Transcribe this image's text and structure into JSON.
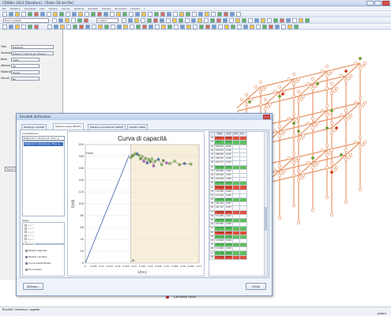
{
  "app": {
    "title": "CDSWin 2013 [Struttura] - [Telaio 3D del file]"
  },
  "menu": [
    "File",
    "Modifica",
    "Visualizza",
    "Dati",
    "Genera",
    "Calcola",
    "Verifiche",
    "Risultati",
    "Stampa",
    "Strumenti",
    "Finestra",
    "?"
  ],
  "toolbar": {
    "combo1": "Travi e pilastri",
    "combo2": "1 piano"
  },
  "left_panel": {
    "rows": [
      {
        "label": "Tipo",
        "value": "Elementi"
      },
      {
        "label": "Sezione",
        "value": "Trave a T (forma e1, Trave a"
      },
      {
        "label": "Base",
        "value": "1000"
      },
      {
        "label": "Altezza",
        "value": "40"
      },
      {
        "label": "Materiale",
        "value": "Guida"
      },
      {
        "label": "Vincoli",
        "value": "No"
      }
    ],
    "status_tab": "Rapporti"
  },
  "dialog": {
    "title": "Risultati dell'analisi",
    "tabs": [
      "Riepilogo risultati",
      "Sistema reale (MDOF)",
      "Sistema equivalente (SDOF)",
      "Spettro ADRS"
    ],
    "combinations_label": "Combinazioni",
    "combination_selected": "Pushover 1 (forma e1, Tran. e",
    "steps_label": "Steps",
    "steps": [
      "Cre 1",
      "Cre 2",
      "Cre 3",
      "Cre 4",
      "Cre 5",
      "Cre 6"
    ],
    "options_label": "Opzioni",
    "options": [
      {
        "label": "Mostra legenda",
        "checked": false
      },
      {
        "label": "Mostra cerniere",
        "checked": true
      },
      {
        "label": "Curva semplificata",
        "checked": true
      },
      {
        "label": "Zoom/Gain",
        "checked": false
      }
    ],
    "buttons": {
      "left": "Stampa...",
      "right": "Chiudi"
    }
  },
  "chart_data": {
    "type": "scatter",
    "title": "Curva di capacità",
    "xlabel": "U[m]",
    "ylabel": "F[kN]",
    "xlim": [
      0,
      0.07
    ],
    "ylim": [
      0,
      200
    ],
    "xticks": [
      "0",
      "0.005",
      "0.01",
      "0.015",
      "0.02",
      "0.025",
      "0.03",
      "0.035",
      "0.04",
      "0.045",
      "0.05",
      "0.055",
      "0.06",
      "0.065",
      "0.07"
    ],
    "yticks": [
      "0",
      "20",
      "40",
      "60",
      "80",
      "100",
      "120",
      "140",
      "160",
      "180",
      "200"
    ],
    "annotations": [
      "Fmax",
      "Dt"
    ],
    "marker_x": 0.028,
    "linear_segment": [
      [
        0,
        0
      ],
      [
        0.027,
        182
      ]
    ],
    "points": [
      {
        "x": 0.028,
        "y": 178,
        "c": "#8fbf5a"
      },
      {
        "x": 0.029,
        "y": 181,
        "c": "#6f9a45"
      },
      {
        "x": 0.03,
        "y": 183,
        "c": "#8fbf5a"
      },
      {
        "x": 0.031,
        "y": 185,
        "c": "#9ad06b"
      },
      {
        "x": 0.032,
        "y": 184,
        "c": "#4f7cc0"
      },
      {
        "x": 0.033,
        "y": 182,
        "c": "#8fbf5a"
      },
      {
        "x": 0.034,
        "y": 176,
        "c": "#6f9a45"
      },
      {
        "x": 0.035,
        "y": 180,
        "c": "#9ad06b"
      },
      {
        "x": 0.036,
        "y": 172,
        "c": "#b86bc9"
      },
      {
        "x": 0.037,
        "y": 177,
        "c": "#8fbf5a"
      },
      {
        "x": 0.038,
        "y": 169,
        "c": "#4f7cc0"
      },
      {
        "x": 0.039,
        "y": 175,
        "c": "#8fbf5a"
      },
      {
        "x": 0.04,
        "y": 171,
        "c": "#6f9a45"
      },
      {
        "x": 0.041,
        "y": 176,
        "c": "#9ad06b"
      },
      {
        "x": 0.042,
        "y": 164,
        "c": "#b86bc9"
      },
      {
        "x": 0.043,
        "y": 172,
        "c": "#8fbf5a"
      },
      {
        "x": 0.045,
        "y": 175,
        "c": "#4f7cc0"
      },
      {
        "x": 0.047,
        "y": 166,
        "c": "#8fbf5a"
      },
      {
        "x": 0.048,
        "y": 173,
        "c": "#6f9a45"
      },
      {
        "x": 0.05,
        "y": 169,
        "c": "#b86bc9"
      },
      {
        "x": 0.052,
        "y": 168,
        "c": "#8fbf5a"
      },
      {
        "x": 0.055,
        "y": 172,
        "c": "#9ad06b"
      },
      {
        "x": 0.058,
        "y": 166,
        "c": "#8fbf5a"
      },
      {
        "x": 0.061,
        "y": 168,
        "c": "#4f7cc0"
      },
      {
        "x": 0.065,
        "y": 167,
        "c": "#8fbf5a"
      }
    ]
  },
  "grid": {
    "headers": [
      "",
      "F[kN]",
      "U[m]",
      "Att%",
      "Pro..."
    ],
    "rows": [
      {
        "id": "40",
        "f": "175.3",
        "u": "0.022",
        "a": "",
        "p": "",
        "c": "r"
      },
      {
        "id": "40",
        "f": "181.6",
        "u": "0.024",
        "a": "",
        "p": "",
        "c": "g"
      },
      {
        "id": "41",
        "f": "180.522",
        "u": "0.025",
        "a": "",
        "p": "",
        "c": "w"
      },
      {
        "id": "42",
        "f": "183.813",
        "u": "0.025",
        "a": "",
        "p": "",
        "c": "w"
      },
      {
        "id": "43",
        "f": "188.626",
        "u": "0.025",
        "a": "",
        "p": "",
        "c": "w"
      },
      {
        "id": "44",
        "f": "182.512",
        "u": "0.025",
        "a": "",
        "p": "",
        "c": "w"
      },
      {
        "id": "45",
        "f": "183.747",
        "u": "0.025",
        "a": "",
        "p": "",
        "c": "w"
      },
      {
        "id": "46",
        "f": "183.742",
        "u": "0.025",
        "a": "",
        "p": "",
        "c": "g"
      },
      {
        "id": "47",
        "f": "184.950",
        "u": "0.025",
        "a": "",
        "p": "",
        "c": "w"
      },
      {
        "id": "48",
        "f": "184.000",
        "u": "0.025",
        "a": "",
        "p": "",
        "c": "w"
      },
      {
        "id": "49",
        "f": "185.444",
        "u": "0.025",
        "a": "",
        "p": "",
        "c": "w"
      },
      {
        "id": "50",
        "f": "184.778",
        "u": "0.025",
        "a": "",
        "p": "",
        "c": "g"
      },
      {
        "id": "51",
        "f": "173.821",
        "u": "0.026",
        "a": "",
        "p": "",
        "c": "r"
      },
      {
        "id": "52",
        "f": "172.500",
        "u": "0.026",
        "a": "",
        "p": "",
        "c": "w"
      },
      {
        "id": "53",
        "f": "171.404",
        "u": "0.026",
        "a": "",
        "p": "",
        "c": "w"
      },
      {
        "id": "54",
        "f": "176.823",
        "u": "0.027",
        "a": "",
        "p": "",
        "c": "g"
      },
      {
        "id": "55",
        "f": "181.229",
        "u": "0.027",
        "a": "",
        "p": "",
        "c": "w"
      },
      {
        "id": "56",
        "f": "181.127",
        "u": "0.027",
        "a": "",
        "p": "",
        "c": "w"
      },
      {
        "id": "57",
        "f": "170.441",
        "u": "0.027",
        "a": "",
        "p": "",
        "c": "r"
      },
      {
        "id": "58",
        "f": "171.650",
        "u": "0.027",
        "a": "",
        "p": "",
        "c": "w"
      },
      {
        "id": "59",
        "f": "186.450",
        "u": "0.028",
        "a": "",
        "p": "",
        "c": "g"
      },
      {
        "id": "60",
        "f": "187.882",
        "u": "0.028",
        "a": "",
        "p": "",
        "c": "w"
      },
      {
        "id": "61",
        "f": "181.020",
        "u": "0.028",
        "a": "",
        "p": "",
        "c": "g"
      },
      {
        "id": "62",
        "f": "175.600",
        "u": "0.028",
        "a": "",
        "p": "",
        "c": "r"
      },
      {
        "id": "63",
        "f": "182.303",
        "u": "0.028",
        "a": "",
        "p": "",
        "c": "g"
      },
      {
        "id": "64",
        "f": "174.804",
        "u": "0.029",
        "a": "",
        "p": "",
        "c": "w"
      },
      {
        "id": "65",
        "f": "183.112",
        "u": "0.029",
        "a": "",
        "p": "",
        "c": "g"
      },
      {
        "id": "66",
        "f": "172.920",
        "u": "0.030",
        "a": "",
        "p": "",
        "c": "w"
      },
      {
        "id": "67",
        "f": "175.108",
        "u": "0.031",
        "a": "",
        "p": "",
        "c": "g"
      },
      {
        "id": "68",
        "f": "176.420",
        "u": "0.031",
        "a": "",
        "p": "",
        "c": "r"
      }
    ]
  },
  "legend": [
    {
      "label": "Cerniere plasticizzate",
      "color": "#2fb82f"
    },
    {
      "label": "Cerniere rotte",
      "color": "#d21f1f"
    }
  ],
  "status": {
    "left": "Risultati: Seleziona i oggetto",
    "right": "pilastri"
  },
  "colors": {
    "frame_member": "#e6966a",
    "hinge_green": "#2fb82f",
    "hinge_red": "#d21f1f",
    "selection": "#2b4f9c"
  }
}
